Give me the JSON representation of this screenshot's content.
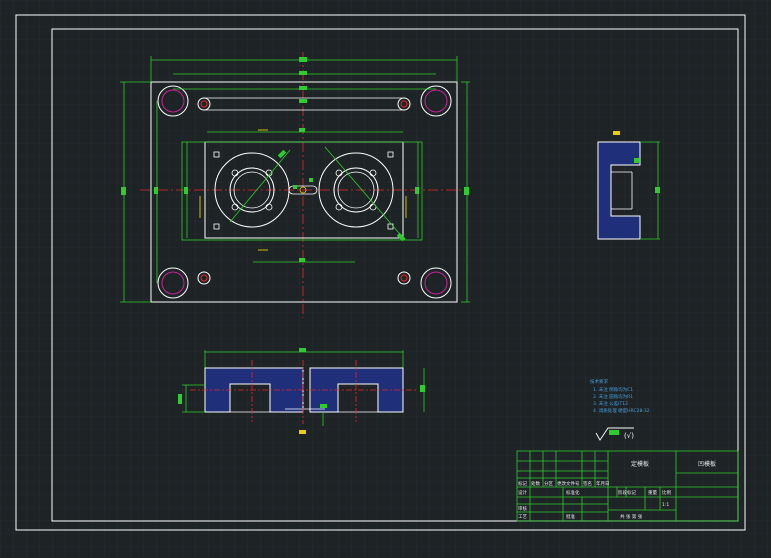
{
  "title_block": {
    "drawing_name": "定模板",
    "drawing_no": "凹模板",
    "row1": [
      "标记",
      "处数",
      "分区",
      "更改文件号",
      "签名",
      "年月日"
    ],
    "labels": {
      "design": "设计",
      "standardization": "标准化",
      "stage_mark": "阶段标记",
      "weight": "重量",
      "scale": "比例",
      "review": "审核",
      "process": "工艺",
      "approve": "批准",
      "sheet_info": "共  张 第  张"
    },
    "scale_value": "1:1"
  },
  "tech_notes": {
    "title": "技术要求",
    "items": [
      "1. 未注 倒角均为C1",
      "2. 未注 圆角均为R1",
      "3. 未注 公差IT12",
      "4. 调质处理 硬度HRC28-32"
    ]
  },
  "roughness": {
    "text": "(√)"
  },
  "colors": {
    "background": "#1e2326",
    "grid": "#2e353a",
    "outline": "#ffffff",
    "dimension": "#2ecc2e",
    "centerline": "#e8262b",
    "hidden": "#e8d000",
    "section_fill": "#1f2f7a",
    "hole": "#c4249a",
    "note": "#4a9ed8"
  }
}
